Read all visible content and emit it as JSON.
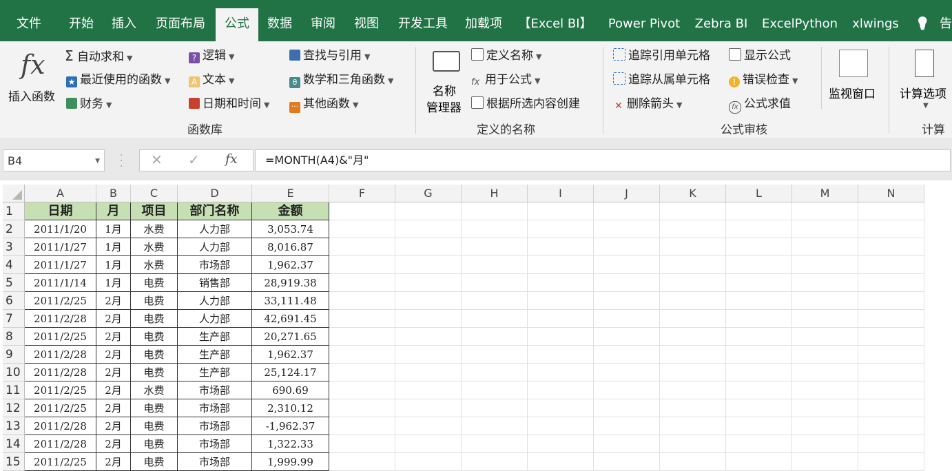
{
  "menu": {
    "tabs": [
      "文件",
      "开始",
      "插入",
      "页面布局",
      "公式",
      "数据",
      "审阅",
      "视图",
      "开发工具",
      "加载项",
      "【Excel BI】",
      "Power Pivot",
      "Zebra BI",
      "ExcelPython",
      "xlwings"
    ],
    "active_tab": "公式",
    "overflow_label": "告"
  },
  "ribbon": {
    "insert_function": "插入函数",
    "autosum": "自动求和",
    "recent": "最近使用的函数",
    "financial": "财务",
    "logical": "逻辑",
    "text": "文本",
    "datetime": "日期和时间",
    "lookup": "查找与引用",
    "math": "数学和三角函数",
    "more": "其他函数",
    "group_library": "函数库",
    "name_manager_1": "名称",
    "name_manager_2": "管理器",
    "define_name": "定义名称",
    "use_in_formula": "用于公式",
    "create_from_selection": "根据所选内容创建",
    "group_names": "定义的名称",
    "trace_precedents": "追踪引用单元格",
    "trace_dependents": "追踪从属单元格",
    "remove_arrows": "删除箭头",
    "show_formulas": "显示公式",
    "error_checking": "错误检查",
    "evaluate_formula": "公式求值",
    "group_audit": "公式审核",
    "watch_window": "监视窗口",
    "calc_options": "计算选项",
    "group_calc": "计算"
  },
  "formula_bar": {
    "name_box": "B4",
    "formula": "=MONTH(A4)&\"月\""
  },
  "sheet": {
    "columns": [
      "A",
      "B",
      "C",
      "D",
      "E",
      "F",
      "G",
      "H",
      "I",
      "J",
      "K",
      "L",
      "M",
      "N"
    ],
    "headers": [
      "日期",
      "月",
      "项目",
      "部门名称",
      "金额"
    ],
    "rows": [
      [
        "2011/1/20",
        "1月",
        "水费",
        "人力部",
        "3,053.74"
      ],
      [
        "2011/1/27",
        "1月",
        "水费",
        "人力部",
        "8,016.87"
      ],
      [
        "2011/1/27",
        "1月",
        "水费",
        "市场部",
        "1,962.37"
      ],
      [
        "2011/1/14",
        "1月",
        "电费",
        "销售部",
        "28,919.38"
      ],
      [
        "2011/2/25",
        "2月",
        "电费",
        "人力部",
        "33,111.48"
      ],
      [
        "2011/2/28",
        "2月",
        "电费",
        "人力部",
        "42,691.45"
      ],
      [
        "2011/2/25",
        "2月",
        "电费",
        "生产部",
        "20,271.65"
      ],
      [
        "2011/2/28",
        "2月",
        "电费",
        "生产部",
        "1,962.37"
      ],
      [
        "2011/2/28",
        "2月",
        "电费",
        "生产部",
        "25,124.17"
      ],
      [
        "2011/2/25",
        "2月",
        "水费",
        "市场部",
        "690.69"
      ],
      [
        "2011/2/25",
        "2月",
        "电费",
        "市场部",
        "2,310.12"
      ],
      [
        "2011/2/28",
        "2月",
        "电费",
        "市场部",
        "-1,962.37"
      ],
      [
        "2011/2/28",
        "2月",
        "电费",
        "市场部",
        "1,322.33"
      ],
      [
        "2011/2/25",
        "2月",
        "电费",
        "市场部",
        "1,999.99"
      ]
    ]
  },
  "colors": {
    "excel_green": "#217346",
    "header_fill": "#c6e0b4"
  }
}
